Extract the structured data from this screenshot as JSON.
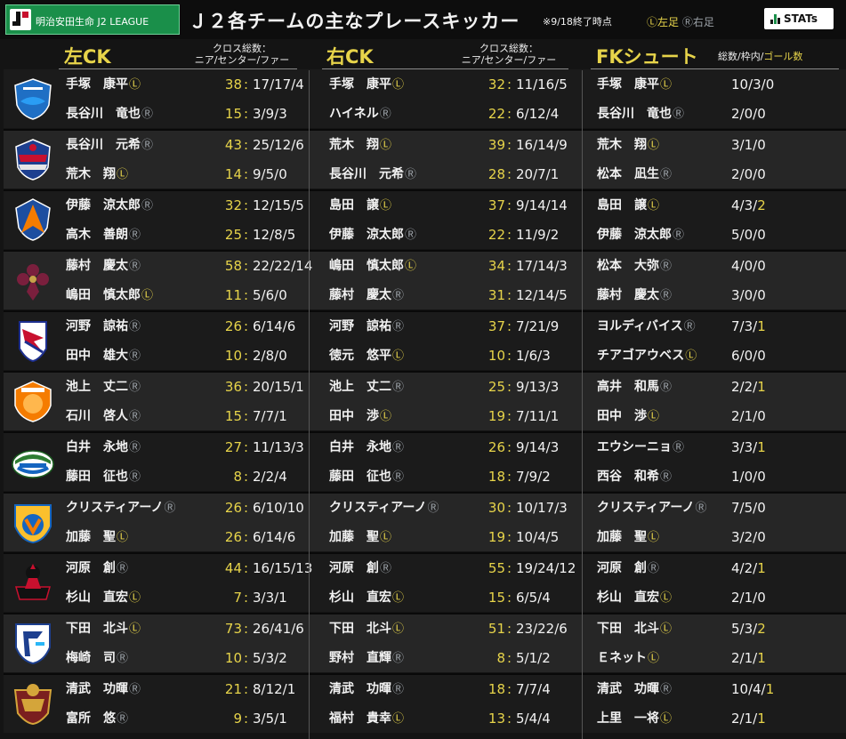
{
  "header": {
    "league_badge": "明治安田生命 J2 LEAGUE",
    "title": "Ｊ２各チームの主なプレースキッカー",
    "as_of": "※9/18終了時点",
    "legend_left": "Ⓛ左足",
    "legend_right": "Ⓡ右足",
    "stats_logo": "STATs"
  },
  "sections": {
    "left_ck": {
      "title": "左CK",
      "sub_line1": "クロス総数：",
      "sub_line2": "ニア/センター/ファー"
    },
    "right_ck": {
      "title": "右CK",
      "sub_line1": "クロス総数：",
      "sub_line2": "ニア/センター/ファー"
    },
    "fk": {
      "title": "FKシュート",
      "sub_prefix": "総数/枠内/",
      "sub_goal": "ゴール数"
    }
  },
  "colors": {
    "gold": "#e7d44a",
    "right_foot": "#9aa0a6",
    "background": "#141414"
  },
  "teams": [
    {
      "crest": "yokohama-fc-crest",
      "left_ck": [
        {
          "name": "手塚　康平",
          "foot": "Ⓛ",
          "total": "38",
          "split": "17/17/4"
        },
        {
          "name": "長谷川　竜也",
          "foot": "Ⓡ",
          "total": "15",
          "split": "3/9/3"
        }
      ],
      "right_ck": [
        {
          "name": "手塚　康平",
          "foot": "Ⓛ",
          "total": "32",
          "split": "11/16/5"
        },
        {
          "name": "ハイネル",
          "foot": "Ⓡ",
          "total": "22",
          "split": "6/12/4"
        }
      ],
      "fk": [
        {
          "name": "手塚　康平",
          "foot": "Ⓛ",
          "shots": "10/3/",
          "goals": "0"
        },
        {
          "name": "長谷川　竜也",
          "foot": "Ⓡ",
          "shots": "2/0/",
          "goals": "0"
        }
      ]
    },
    {
      "crest": "ventforet-kofu-crest",
      "left_ck": [
        {
          "name": "長谷川　元希",
          "foot": "Ⓡ",
          "total": "43",
          "split": "25/12/6"
        },
        {
          "name": "荒木　翔",
          "foot": "Ⓛ",
          "total": "14",
          "split": "9/5/0"
        }
      ],
      "right_ck": [
        {
          "name": "荒木　翔",
          "foot": "Ⓛ",
          "total": "39",
          "split": "16/14/9"
        },
        {
          "name": "長谷川　元希",
          "foot": "Ⓡ",
          "total": "28",
          "split": "20/7/1"
        }
      ],
      "fk": [
        {
          "name": "荒木　翔",
          "foot": "Ⓛ",
          "shots": "3/1/",
          "goals": "0"
        },
        {
          "name": "松本　凪生",
          "foot": "Ⓡ",
          "shots": "2/0/",
          "goals": "0"
        }
      ]
    },
    {
      "crest": "albirex-niigata-crest",
      "left_ck": [
        {
          "name": "伊藤　涼太郎",
          "foot": "Ⓡ",
          "total": "32",
          "split": "12/15/5"
        },
        {
          "name": "高木　善朗",
          "foot": "Ⓡ",
          "total": "25",
          "split": "12/8/5"
        }
      ],
      "right_ck": [
        {
          "name": "島田　譲",
          "foot": "Ⓛ",
          "total": "37",
          "split": "9/14/14"
        },
        {
          "name": "伊藤　涼太郎",
          "foot": "Ⓡ",
          "total": "22",
          "split": "11/9/2"
        }
      ],
      "fk": [
        {
          "name": "島田　譲",
          "foot": "Ⓛ",
          "shots": "4/3/",
          "goals": "2"
        },
        {
          "name": "伊藤　涼太郎",
          "foot": "Ⓡ",
          "shots": "5/0/",
          "goals": "0"
        }
      ]
    },
    {
      "crest": "kyoto-sanga-crest",
      "left_ck": [
        {
          "name": "藤村　慶太",
          "foot": "Ⓡ",
          "total": "58",
          "split": "22/22/14"
        },
        {
          "name": "嶋田　慎太郎",
          "foot": "Ⓛ",
          "total": "11",
          "split": "5/6/0"
        }
      ],
      "right_ck": [
        {
          "name": "嶋田　慎太郎",
          "foot": "Ⓛ",
          "total": "34",
          "split": "17/14/3"
        },
        {
          "name": "藤村　慶太",
          "foot": "Ⓡ",
          "total": "31",
          "split": "12/14/5"
        }
      ],
      "fk": [
        {
          "name": "松本　大弥",
          "foot": "Ⓡ",
          "shots": "4/0/",
          "goals": "0"
        },
        {
          "name": "藤村　慶太",
          "foot": "Ⓡ",
          "shots": "3/0/",
          "goals": "0"
        }
      ]
    },
    {
      "crest": "mito-hollyhock-crest",
      "left_ck": [
        {
          "name": "河野　諒祐",
          "foot": "Ⓡ",
          "total": "26",
          "split": "6/14/6"
        },
        {
          "name": "田中　雄大",
          "foot": "Ⓡ",
          "total": "10",
          "split": "2/8/0"
        }
      ],
      "right_ck": [
        {
          "name": "河野　諒祐",
          "foot": "Ⓡ",
          "total": "37",
          "split": "7/21/9"
        },
        {
          "name": "徳元　悠平",
          "foot": "Ⓛ",
          "total": "10",
          "split": "1/6/3"
        }
      ],
      "fk": [
        {
          "name": "ヨルディバイス",
          "foot": "Ⓡ",
          "shots": "7/3/",
          "goals": "1"
        },
        {
          "name": "チアゴアウベス",
          "foot": "Ⓛ",
          "shots": "6/0/",
          "goals": "0"
        }
      ]
    },
    {
      "crest": "renofa-yamaguchi-crest",
      "left_ck": [
        {
          "name": "池上　丈二",
          "foot": "Ⓡ",
          "total": "36",
          "split": "20/15/1"
        },
        {
          "name": "石川　啓人",
          "foot": "Ⓡ",
          "total": "15",
          "split": "7/7/1"
        }
      ],
      "right_ck": [
        {
          "name": "池上　丈二",
          "foot": "Ⓡ",
          "total": "25",
          "split": "9/13/3"
        },
        {
          "name": "田中　渉",
          "foot": "Ⓛ",
          "total": "19",
          "split": "7/11/1"
        }
      ],
      "fk": [
        {
          "name": "高井　和馬",
          "foot": "Ⓡ",
          "shots": "2/2/",
          "goals": "1"
        },
        {
          "name": "田中　渉",
          "foot": "Ⓛ",
          "shots": "2/1/",
          "goals": "0"
        }
      ]
    },
    {
      "crest": "tokushima-vortis-crest",
      "left_ck": [
        {
          "name": "白井　永地",
          "foot": "Ⓡ",
          "total": "27",
          "split": "11/13/3"
        },
        {
          "name": "藤田　征也",
          "foot": "Ⓡ",
          "total": "8",
          "split": "2/2/4"
        }
      ],
      "right_ck": [
        {
          "name": "白井　永地",
          "foot": "Ⓡ",
          "total": "26",
          "split": "9/14/3"
        },
        {
          "name": "藤田　征也",
          "foot": "Ⓡ",
          "total": "18",
          "split": "7/9/2"
        }
      ],
      "fk": [
        {
          "name": "エウシーニョ",
          "foot": "Ⓡ",
          "shots": "3/3/",
          "goals": "1"
        },
        {
          "name": "西谷　和希",
          "foot": "Ⓡ",
          "shots": "1/0/",
          "goals": "0"
        }
      ]
    },
    {
      "crest": "v-varen-nagasaki-crest",
      "left_ck": [
        {
          "name": "クリスティアーノ",
          "foot": "Ⓡ",
          "total": "26",
          "split": "6/10/10"
        },
        {
          "name": "加藤　聖",
          "foot": "Ⓛ",
          "total": "26",
          "split": "6/14/6"
        }
      ],
      "right_ck": [
        {
          "name": "クリスティアーノ",
          "foot": "Ⓡ",
          "total": "30",
          "split": "10/17/3"
        },
        {
          "name": "加藤　聖",
          "foot": "Ⓛ",
          "total": "19",
          "split": "10/4/5"
        }
      ],
      "fk": [
        {
          "name": "クリスティアーノ",
          "foot": "Ⓡ",
          "shots": "7/5/",
          "goals": "0"
        },
        {
          "name": "加藤　聖",
          "foot": "Ⓛ",
          "shots": "3/2/",
          "goals": "0"
        }
      ]
    },
    {
      "crest": "consadole-style-crest",
      "left_ck": [
        {
          "name": "河原　創",
          "foot": "Ⓡ",
          "total": "44",
          "split": "16/15/13"
        },
        {
          "name": "杉山　直宏",
          "foot": "Ⓛ",
          "total": "7",
          "split": "3/3/1"
        }
      ],
      "right_ck": [
        {
          "name": "河原　創",
          "foot": "Ⓡ",
          "total": "55",
          "split": "19/24/12"
        },
        {
          "name": "杉山　直宏",
          "foot": "Ⓛ",
          "total": "15",
          "split": "6/5/4"
        }
      ],
      "fk": [
        {
          "name": "河原　創",
          "foot": "Ⓡ",
          "shots": "4/2/",
          "goals": "1"
        },
        {
          "name": "杉山　直宏",
          "foot": "Ⓛ",
          "shots": "2/1/",
          "goals": "0"
        }
      ]
    },
    {
      "crest": "fc-ryukyu-crest",
      "left_ck": [
        {
          "name": "下田　北斗",
          "foot": "Ⓛ",
          "total": "73",
          "split": "26/41/6"
        },
        {
          "name": "梅崎　司",
          "foot": "Ⓡ",
          "total": "10",
          "split": "5/3/2"
        }
      ],
      "right_ck": [
        {
          "name": "下田　北斗",
          "foot": "Ⓛ",
          "total": "51",
          "split": "23/22/6"
        },
        {
          "name": "野村　直輝",
          "foot": "Ⓡ",
          "total": "8",
          "split": "5/1/2"
        }
      ],
      "fk": [
        {
          "name": "下田　北斗",
          "foot": "Ⓛ",
          "shots": "5/3/",
          "goals": "2"
        },
        {
          "name": "Ｅネット",
          "foot": "Ⓛ",
          "shots": "2/1/",
          "goals": "1"
        }
      ]
    },
    {
      "crest": "blaublitz-style-crest",
      "left_ck": [
        {
          "name": "清武　功暉",
          "foot": "Ⓡ",
          "total": "21",
          "split": "8/12/1"
        },
        {
          "name": "富所　悠",
          "foot": "Ⓡ",
          "total": "9",
          "split": "3/5/1"
        }
      ],
      "right_ck": [
        {
          "name": "清武　功暉",
          "foot": "Ⓡ",
          "total": "18",
          "split": "7/7/4"
        },
        {
          "name": "福村　貴幸",
          "foot": "Ⓛ",
          "total": "13",
          "split": "5/4/4"
        }
      ],
      "fk": [
        {
          "name": "清武　功暉",
          "foot": "Ⓡ",
          "shots": "10/4/",
          "goals": "1"
        },
        {
          "name": "上里　一将",
          "foot": "Ⓛ",
          "shots": "2/1/",
          "goals": "1"
        }
      ]
    }
  ]
}
